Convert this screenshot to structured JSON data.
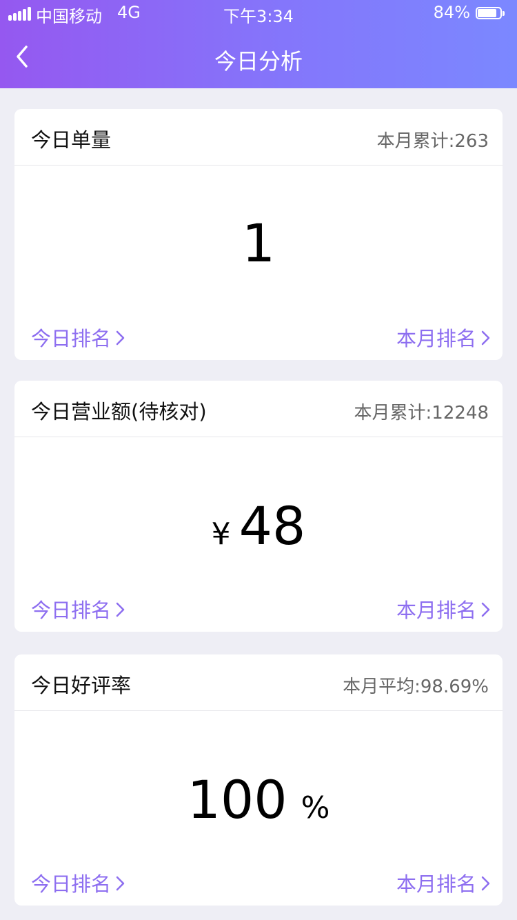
{
  "status_bar": {
    "carrier": "中国移动",
    "network": "4G",
    "time": "下午3:34",
    "battery_percent_label": "84%",
    "battery_level": 0.84
  },
  "header": {
    "title": "今日分析",
    "back_icon": "chevron-left-icon"
  },
  "cards": [
    {
      "title": "今日单量",
      "summary": "本月累计:263",
      "prefix": "",
      "value": "1",
      "suffix": "",
      "rank_today": "今日排名",
      "rank_month": "本月排名"
    },
    {
      "title": "今日营业额(待核对)",
      "summary": "本月累计:12248",
      "prefix": "¥",
      "value": "48",
      "suffix": "",
      "rank_today": "今日排名",
      "rank_month": "本月排名"
    },
    {
      "title": "今日好评率",
      "summary": "本月平均:98.69%",
      "prefix": "",
      "value": "100",
      "suffix": "%",
      "rank_today": "今日排名",
      "rank_month": "本月排名"
    }
  ],
  "colors": {
    "header_gradient_start": "#9558f0",
    "header_gradient_end": "#7b88ff",
    "link": "#8d6ef0",
    "background": "#eeeef5"
  }
}
